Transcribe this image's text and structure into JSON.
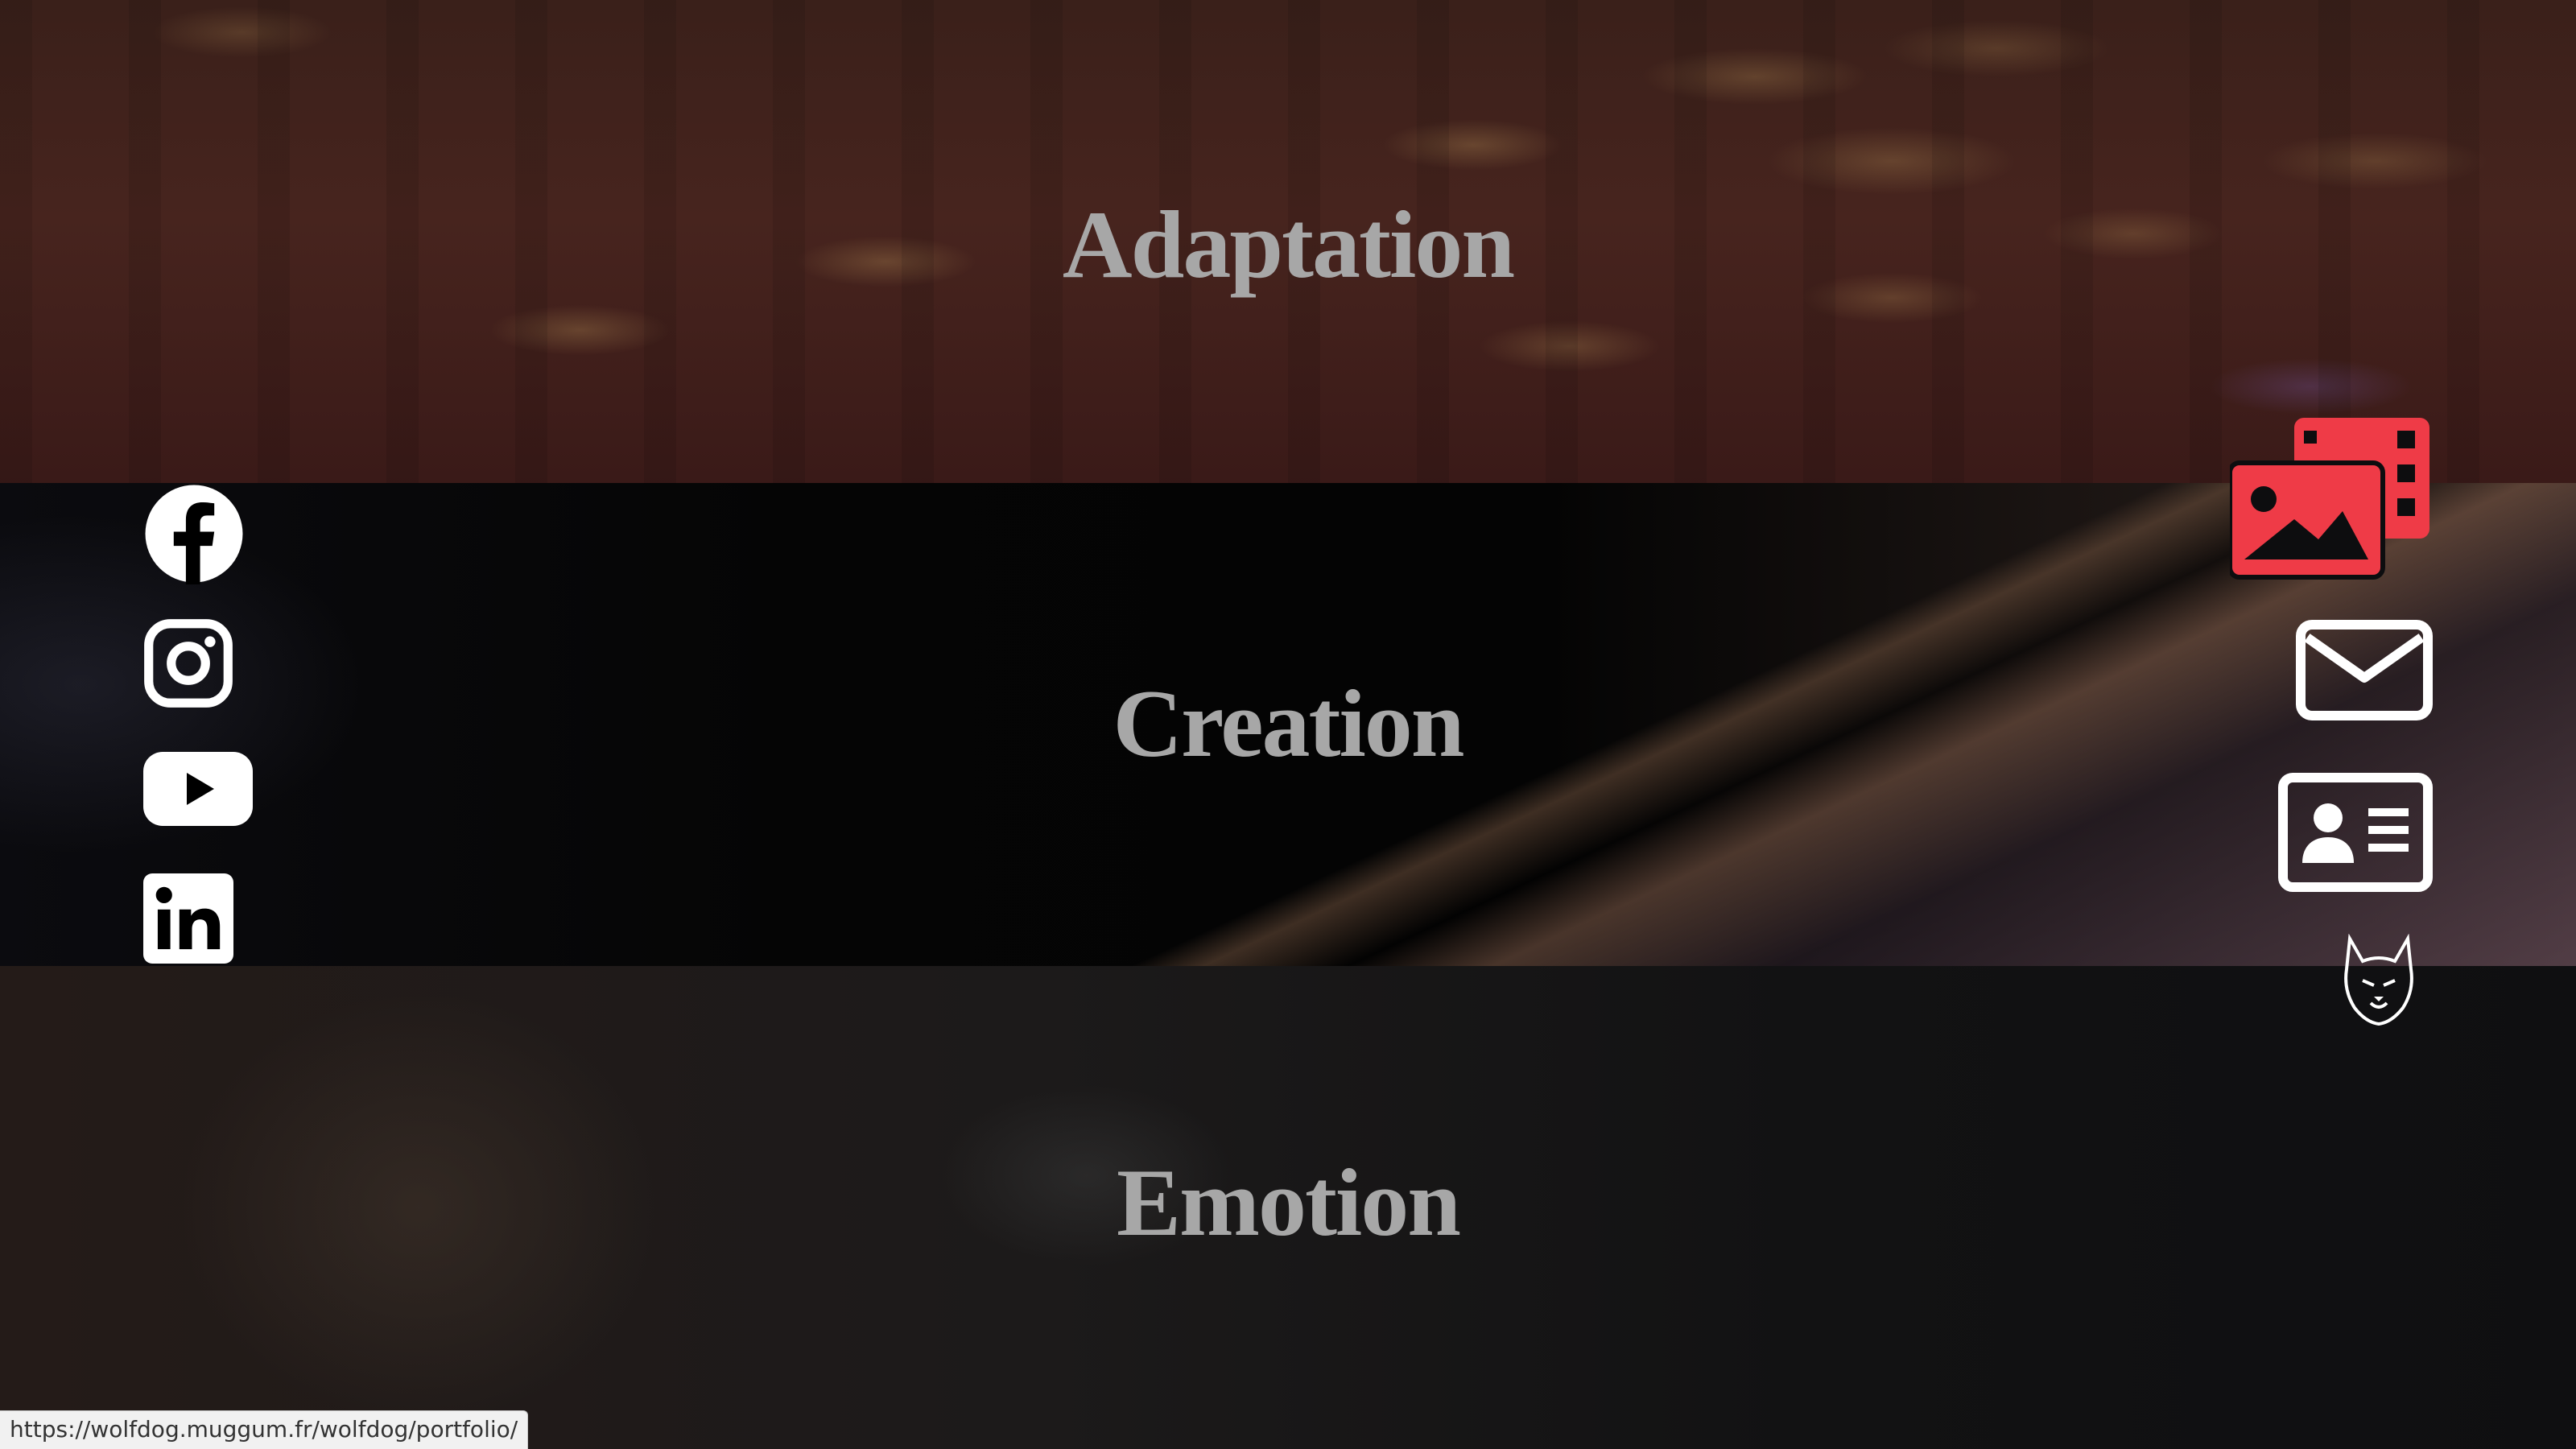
{
  "sections": [
    {
      "title": "Adaptation"
    },
    {
      "title": "Creation"
    },
    {
      "title": "Emotion"
    }
  ],
  "social": {
    "items": [
      {
        "name": "facebook-icon"
      },
      {
        "name": "instagram-icon"
      },
      {
        "name": "youtube-icon"
      },
      {
        "name": "linkedin-icon"
      }
    ]
  },
  "nav": {
    "items": [
      {
        "name": "gallery-icon",
        "color": "#ef3b47"
      },
      {
        "name": "mail-icon",
        "color": "#ffffff"
      },
      {
        "name": "contact-card-icon",
        "color": "#ffffff"
      },
      {
        "name": "wolf-logo"
      }
    ]
  },
  "status_bar": {
    "url": "https://wolfdog.muggum.fr/wolfdog/portfolio/"
  }
}
